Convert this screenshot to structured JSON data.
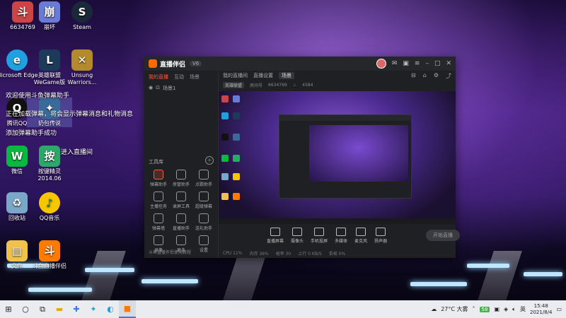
{
  "desktop": {
    "icons": [
      {
        "label": "6634769",
        "label2": "6634769"
      },
      {
        "label": "崩坏"
      },
      {
        "label": "Steam"
      },
      {
        "label": "Microsoft Edge"
      },
      {
        "label": "英雄联盟 WeGame版"
      },
      {
        "label": "Unsung Warriors..."
      },
      {
        "label": "腾讯QQ"
      },
      {
        "label": "奶包传说"
      },
      {
        "label": "微信"
      },
      {
        "label": "按键精灵 2014.06"
      },
      {
        "label": "回收站"
      },
      {
        "label": "QQ音乐"
      },
      {
        "label": "文件"
      },
      {
        "label": "斗鱼直播伴侣"
      }
    ],
    "notifications": {
      "n1": "欢迎使用斗鱼弹幕助手",
      "n2": "正在加载弹幕，将会显示弹幕消息和礼物消息",
      "n3": "添加弹幕助手成功",
      "n4": "进入直播间"
    }
  },
  "app": {
    "title": "直播伴侣",
    "version": "V6",
    "left_tabs": [
      "我的直播",
      "互动",
      "场景"
    ],
    "layer_label": "场景1",
    "tools_title": "工具库",
    "tools": [
      "弹幕助手",
      "房管助手",
      "点歌助手",
      "主播任务",
      "录屏工具",
      "超级弹幕",
      "弹幕墙",
      "直播助手",
      "送礼助手",
      "录像",
      "更多",
      "设置"
    ],
    "left_footer": "斗鱼直播伴侣使用教程",
    "main_tabs": [
      "我的直播间",
      "直播设置",
      "场景"
    ],
    "info": {
      "category": "英雄联盟",
      "room_label": "房间号",
      "room": "6634769",
      "hot": "4584"
    },
    "toolbar": [
      "直播屏幕",
      "摄像头",
      "手机投屏",
      "多媒体",
      "麦克风",
      "扬声器"
    ],
    "go_live": "开始直播",
    "status": [
      "CPU 11%",
      "内存 36%",
      "帧率 30",
      "上行 0 KB/S",
      "丢帧 0%"
    ]
  },
  "taskbar": {
    "weather": "27°C 大雾",
    "battery": "58",
    "ime": "英",
    "time": "15:48",
    "date": "2021/8/4"
  }
}
